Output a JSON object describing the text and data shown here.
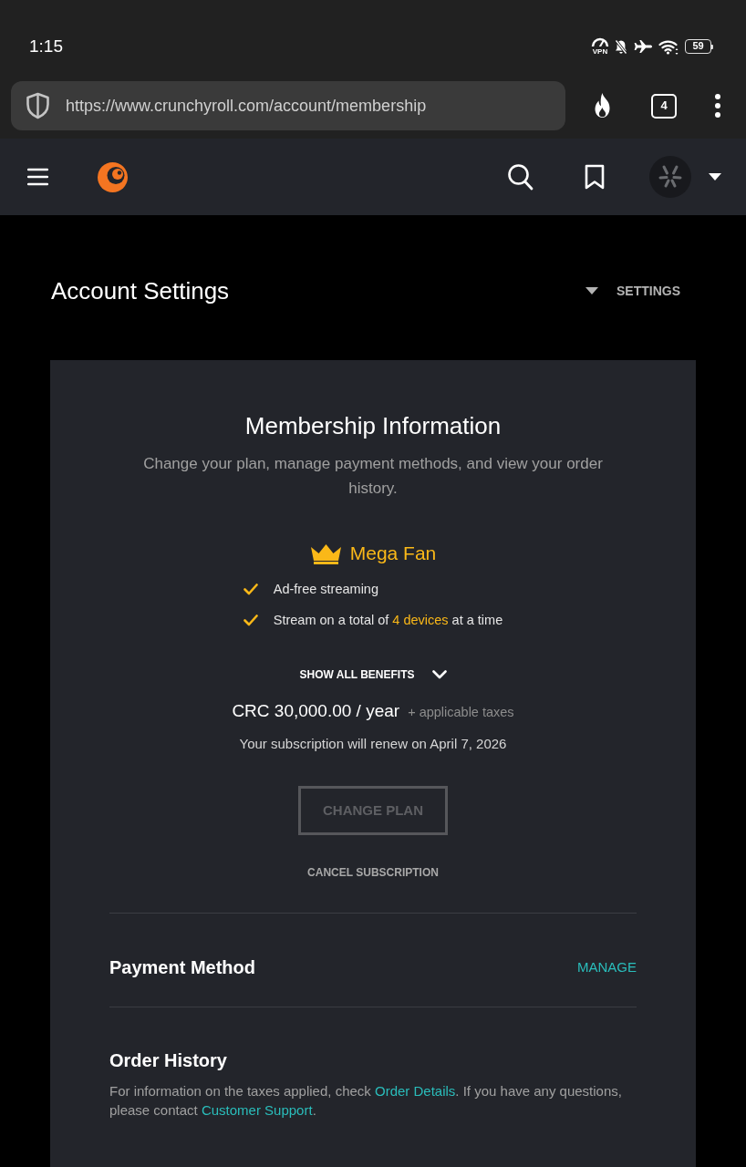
{
  "status_bar": {
    "time": "1:15",
    "vpn_label": "VPN",
    "battery": "59"
  },
  "browser": {
    "url": "https://www.crunchyroll.com/account/membership",
    "tab_count": "4"
  },
  "page": {
    "title": "Account Settings",
    "settings_label": "SETTINGS"
  },
  "membership": {
    "title": "Membership Information",
    "description": "Change your plan, manage payment methods, and view your order history.",
    "plan": {
      "name": "Mega Fan",
      "benefits": [
        {
          "parts": [
            {
              "kind": "text",
              "text": "Ad-free streaming"
            }
          ]
        },
        {
          "parts": [
            {
              "kind": "text",
              "text": "Stream on a total of "
            },
            {
              "kind": "highlight",
              "text": "4 devices"
            },
            {
              "kind": "text",
              "text": " at a time"
            }
          ]
        }
      ]
    },
    "show_benefits": {
      "label": "SHOW ALL BENEFITS",
      "expanded": false
    },
    "price": "CRC 30,000.00 / year",
    "tax_note": "+ applicable taxes",
    "renewal": "Your subscription will renew on April 7, 2026",
    "change_plan": {
      "label": "CHANGE PLAN",
      "disabled": true
    },
    "cancel_label": "CANCEL SUBSCRIPTION"
  },
  "payment_method": {
    "title": "Payment Method",
    "action": "MANAGE"
  },
  "order_history": {
    "title": "Order History",
    "text_parts": [
      {
        "kind": "text",
        "text": "For information on the taxes applied, check "
      },
      {
        "kind": "link",
        "text": "Order Details"
      },
      {
        "kind": "text",
        "text": ". If you have any questions, please contact "
      },
      {
        "kind": "link",
        "text": "Customer Support"
      },
      {
        "kind": "text",
        "text": "."
      }
    ]
  }
}
